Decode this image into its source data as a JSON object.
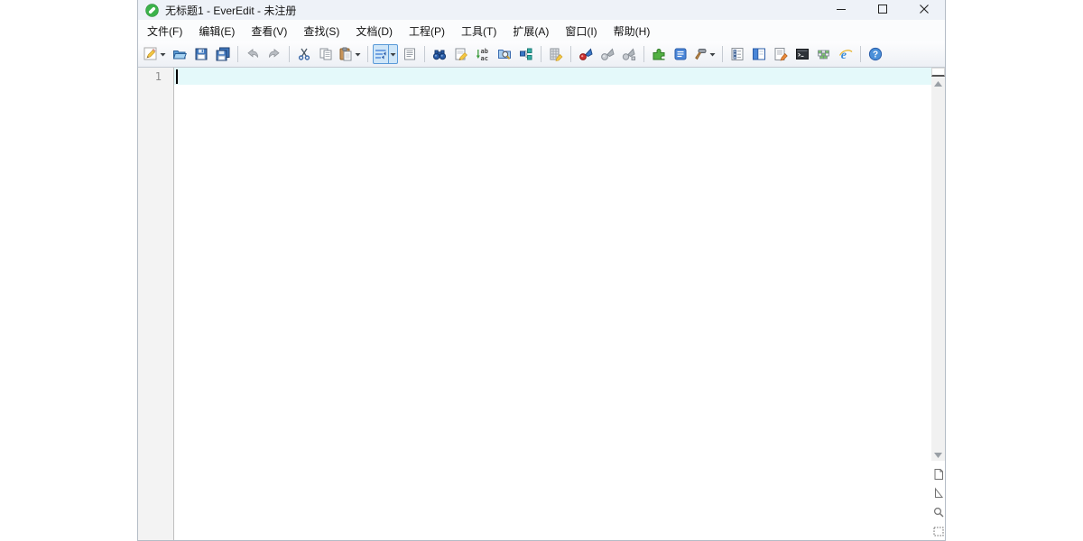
{
  "window": {
    "title": "无标题1 - EverEdit - 未注册",
    "controls": [
      {
        "name": "minimize-button",
        "icon": "minimize-icon"
      },
      {
        "name": "maximize-button",
        "icon": "maximize-icon"
      },
      {
        "name": "close-button",
        "icon": "close-icon"
      }
    ]
  },
  "menu": {
    "items": [
      {
        "name": "file",
        "label": "文件(F)"
      },
      {
        "name": "edit",
        "label": "编辑(E)"
      },
      {
        "name": "view",
        "label": "查看(V)"
      },
      {
        "name": "search",
        "label": "查找(S)"
      },
      {
        "name": "document",
        "label": "文档(D)"
      },
      {
        "name": "project",
        "label": "工程(P)"
      },
      {
        "name": "tools",
        "label": "工具(T)"
      },
      {
        "name": "extensions",
        "label": "扩展(A)"
      },
      {
        "name": "window",
        "label": "窗口(I)"
      },
      {
        "name": "help",
        "label": "帮助(H)"
      }
    ]
  },
  "toolbar": {
    "items": [
      {
        "type": "button",
        "name": "new-file",
        "icon": "new-file-pencil-icon",
        "dropdown": true
      },
      {
        "type": "button",
        "name": "open-file",
        "icon": "open-folder-icon"
      },
      {
        "type": "button",
        "name": "save",
        "icon": "save-floppy-icon"
      },
      {
        "type": "button",
        "name": "save-all",
        "icon": "save-all-icon"
      },
      {
        "type": "sep"
      },
      {
        "type": "button",
        "name": "undo",
        "icon": "undo-arrow-icon",
        "disabled": true
      },
      {
        "type": "button",
        "name": "redo",
        "icon": "redo-arrow-icon",
        "disabled": true
      },
      {
        "type": "sep"
      },
      {
        "type": "button",
        "name": "cut",
        "icon": "cut-scissors-icon"
      },
      {
        "type": "button",
        "name": "copy",
        "icon": "copy-pages-icon"
      },
      {
        "type": "button",
        "name": "paste",
        "icon": "paste-clipboard-icon",
        "dropdown": true
      },
      {
        "type": "sep"
      },
      {
        "type": "button",
        "name": "word-wrap",
        "icon": "word-wrap-icon",
        "dropdown": true,
        "selected": true
      },
      {
        "type": "button",
        "name": "show-symbols",
        "icon": "document-lines-icon"
      },
      {
        "type": "sep"
      },
      {
        "type": "button",
        "name": "find",
        "icon": "binoculars-icon"
      },
      {
        "type": "button",
        "name": "quick-replace",
        "icon": "page-pencil-icon"
      },
      {
        "type": "button",
        "name": "replace",
        "icon": "replace-ab-ac-icon"
      },
      {
        "type": "button",
        "name": "find-in-files",
        "icon": "folder-magnifier-icon"
      },
      {
        "type": "button",
        "name": "compare",
        "icon": "linked-blocks-icon"
      },
      {
        "type": "sep"
      },
      {
        "type": "button",
        "name": "hex-edit",
        "icon": "grid-pencil-icon"
      },
      {
        "type": "sep"
      },
      {
        "type": "button",
        "name": "record-macro",
        "icon": "record-macro-icon"
      },
      {
        "type": "button",
        "name": "play-macro",
        "icon": "play-macro-icon",
        "disabled": true
      },
      {
        "type": "button",
        "name": "run-macro-multi",
        "icon": "run-macro-multi-icon",
        "disabled": true
      },
      {
        "type": "sep"
      },
      {
        "type": "button",
        "name": "plugin-manager",
        "icon": "green-puzzle-icon"
      },
      {
        "type": "button",
        "name": "snippet-list",
        "icon": "blue-list-icon"
      },
      {
        "type": "button",
        "name": "external-tools",
        "icon": "hammer-icon",
        "dropdown": true
      },
      {
        "type": "sep"
      },
      {
        "type": "button",
        "name": "outline",
        "icon": "outline-list-icon"
      },
      {
        "type": "button",
        "name": "sidebar-toggle",
        "icon": "sidebar-panel-icon"
      },
      {
        "type": "button",
        "name": "edit-markup",
        "icon": "document-pencil-icon"
      },
      {
        "type": "button",
        "name": "terminal",
        "icon": "console-window-icon"
      },
      {
        "type": "button",
        "name": "color-grid",
        "icon": "table-grid-icon"
      },
      {
        "type": "button",
        "name": "browser-preview",
        "icon": "ie-browser-icon"
      },
      {
        "type": "sep"
      },
      {
        "type": "button",
        "name": "help",
        "icon": "help-question-icon"
      }
    ]
  },
  "editor": {
    "line_number": "1",
    "content": "",
    "caret_visible": true
  },
  "scrollbar": {
    "side_buttons": [
      {
        "name": "rail-page-button",
        "icon": "new-page-icon"
      },
      {
        "name": "rail-pointer-button",
        "icon": "cursor-triangle-icon"
      },
      {
        "name": "rail-zoom-button",
        "icon": "magnifier-icon"
      },
      {
        "name": "rail-select-button",
        "icon": "selection-marquee-icon"
      }
    ]
  },
  "colors": {
    "titlebar_bg": "#eef2f8",
    "toolbar_selected_bg": "#cfe6f8",
    "toolbar_selected_border": "#5a9ad8",
    "current_line_bg": "#e4f9fa",
    "gutter_bg": "#f3f3f3",
    "logo_green": "#3bb24a"
  }
}
